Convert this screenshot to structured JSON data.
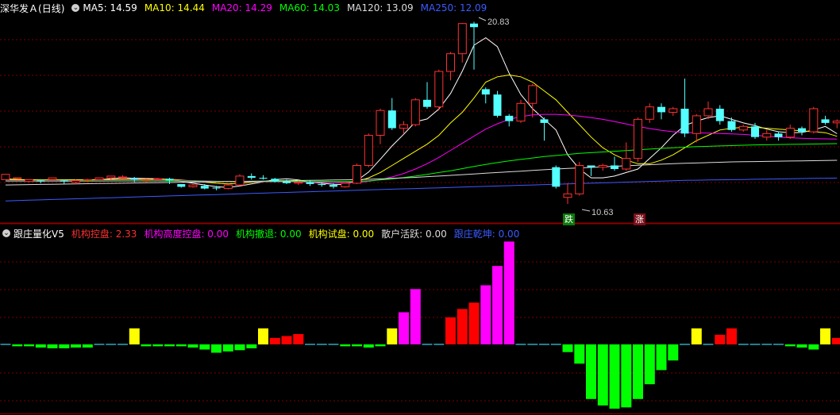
{
  "header_main": {
    "stock": "深华发Ａ",
    "period": "(日线)",
    "indicators": [
      {
        "label": "MA5: 14.59",
        "color": "#ffffff"
      },
      {
        "label": "MA10: 14.44",
        "color": "#ffff00"
      },
      {
        "label": "MA20: 14.29",
        "color": "#ff00ff"
      },
      {
        "label": "MA60: 14.03",
        "color": "#00ff00"
      },
      {
        "label": "MA120: 13.09",
        "color": "#dcdcdc"
      },
      {
        "label": "MA250: 12.09",
        "color": "#3b5bff"
      }
    ]
  },
  "header_sub": {
    "name": "跟庄量化V5",
    "indicators": [
      {
        "label": "机构控盘: 2.33",
        "color": "#ff3030"
      },
      {
        "label": "机构高度控盘: 0.00",
        "color": "#ff00ff"
      },
      {
        "label": "机构撤退: 0.00",
        "color": "#00ff00"
      },
      {
        "label": "机构试盘: 0.00",
        "color": "#ffff00"
      },
      {
        "label": "散户活跃: 0.00",
        "color": "#dcdcdc"
      },
      {
        "label": "跟庄乾坤: 0.00",
        "color": "#3b5bff"
      }
    ]
  },
  "annotations": {
    "high": "20.83",
    "low": "10.63",
    "fall_marker": "跌",
    "rise_marker": "涨"
  },
  "colors": {
    "up": "#ff3030",
    "down": "#54ffff",
    "ma5": "#ffffff",
    "ma10": "#ffff00",
    "ma20": "#ff00ff",
    "ma60": "#00ff00",
    "ma120": "#dcdcdc",
    "ma250": "#3b5bff",
    "grid": "#7a0000",
    "separator": "#8b0000"
  },
  "chart_data": [
    {
      "type": "candlestick",
      "title": "深华发Ａ (日线)",
      "price_range": [
        10.0,
        21.8
      ],
      "candles": [
        [
          12.0,
          12.3,
          12.0,
          12.1
        ],
        [
          12.1,
          12.1,
          11.95,
          11.9
        ],
        [
          11.9,
          12.0,
          11.85,
          11.95
        ],
        [
          11.95,
          11.9,
          11.8,
          12.0
        ],
        [
          12.0,
          12.1,
          11.9,
          11.95
        ],
        [
          11.95,
          11.9,
          11.75,
          12.0
        ],
        [
          11.85,
          11.95,
          11.75,
          12.0
        ],
        [
          11.95,
          12.0,
          11.85,
          12.05
        ],
        [
          12.0,
          12.1,
          11.95,
          12.1
        ],
        [
          12.1,
          12.2,
          12.0,
          12.15
        ],
        [
          12.15,
          12.15,
          12.05,
          12.25
        ],
        [
          12.1,
          12.0,
          11.85,
          12.15
        ],
        [
          11.95,
          12.0,
          11.85,
          12.05
        ],
        [
          12.0,
          12.05,
          11.9,
          12.1
        ],
        [
          12.05,
          11.95,
          11.75,
          12.1
        ],
        [
          11.75,
          11.6,
          11.55,
          11.75
        ],
        [
          11.6,
          11.7,
          11.55,
          11.75
        ],
        [
          11.65,
          11.5,
          11.45,
          11.75
        ],
        [
          11.55,
          11.5,
          11.4,
          11.65
        ],
        [
          11.5,
          11.7,
          11.45,
          11.75
        ],
        [
          11.7,
          12.2,
          11.65,
          12.3
        ],
        [
          12.2,
          12.1,
          12.0,
          12.35
        ],
        [
          12.1,
          12.05,
          12.0,
          12.25
        ],
        [
          12.05,
          11.9,
          11.85,
          12.1
        ],
        [
          11.9,
          11.8,
          11.75,
          12.0
        ],
        [
          11.8,
          11.85,
          11.7,
          11.95
        ],
        [
          11.85,
          11.75,
          11.65,
          11.95
        ],
        [
          11.75,
          11.7,
          11.6,
          11.85
        ],
        [
          11.7,
          11.6,
          11.5,
          11.8
        ],
        [
          11.6,
          11.8,
          11.55,
          11.85
        ],
        [
          11.8,
          12.8,
          11.75,
          12.9
        ],
        [
          12.8,
          14.5,
          12.7,
          14.6
        ],
        [
          14.5,
          15.9,
          14.0,
          16.0
        ],
        [
          15.9,
          14.9,
          14.8,
          16.6
        ],
        [
          14.9,
          15.1,
          14.6,
          15.3
        ],
        [
          15.1,
          16.5,
          15.0,
          16.6
        ],
        [
          16.5,
          16.1,
          16.0,
          17.5
        ],
        [
          16.1,
          18.1,
          15.9,
          18.2
        ],
        [
          18.1,
          19.1,
          17.6,
          19.2
        ],
        [
          19.1,
          20.8,
          18.6,
          20.83
        ],
        [
          20.8,
          20.6,
          18.2,
          20.9
        ],
        [
          17.1,
          16.8,
          16.3,
          17.2
        ],
        [
          16.8,
          15.6,
          15.5,
          17.0
        ],
        [
          15.6,
          15.3,
          15.0,
          15.7
        ],
        [
          15.3,
          16.3,
          15.2,
          16.5
        ],
        [
          16.3,
          17.3,
          15.5,
          17.4
        ],
        [
          15.4,
          15.2,
          14.2,
          15.5
        ],
        [
          12.7,
          11.6,
          11.5,
          12.8
        ],
        [
          11.0,
          11.2,
          10.63,
          11.8
        ],
        [
          11.2,
          12.8,
          11.1,
          13.0
        ],
        [
          12.8,
          12.7,
          12.2,
          12.8
        ],
        [
          12.7,
          12.8,
          12.5,
          12.9
        ],
        [
          12.8,
          12.6,
          12.5,
          13.3
        ],
        [
          12.6,
          13.2,
          12.5,
          14.1
        ],
        [
          13.2,
          15.4,
          13.0,
          15.5
        ],
        [
          15.4,
          16.1,
          15.2,
          16.3
        ],
        [
          16.1,
          15.8,
          15.4,
          16.3
        ],
        [
          15.8,
          16.0,
          15.6,
          16.1
        ],
        [
          16.0,
          14.6,
          14.4,
          17.7
        ],
        [
          14.6,
          15.6,
          14.1,
          15.7
        ],
        [
          15.6,
          16.0,
          15.4,
          16.4
        ],
        [
          16.0,
          15.3,
          15.1,
          16.2
        ],
        [
          15.3,
          14.8,
          14.7,
          15.5
        ],
        [
          14.8,
          15.0,
          14.7,
          15.1
        ],
        [
          15.0,
          14.4,
          14.3,
          15.2
        ],
        [
          14.4,
          14.6,
          14.2,
          14.8
        ],
        [
          14.6,
          14.4,
          14.2,
          14.7
        ],
        [
          14.4,
          14.9,
          14.3,
          15.1
        ],
        [
          14.9,
          14.7,
          14.5,
          15.0
        ],
        [
          14.7,
          16.0,
          14.6,
          16.1
        ],
        [
          15.4,
          15.2,
          15.1,
          15.6
        ],
        [
          15.2,
          15.3,
          14.9,
          15.4
        ]
      ],
      "ma": {
        "ma5": [
          12.05,
          12.0,
          11.98,
          11.97,
          11.97,
          11.98,
          11.98,
          11.98,
          12.0,
          12.05,
          12.1,
          12.08,
          12.06,
          12.05,
          12.0,
          11.9,
          11.8,
          11.7,
          11.6,
          11.56,
          11.64,
          11.76,
          11.88,
          12.0,
          12.05,
          11.98,
          11.86,
          11.8,
          11.74,
          11.72,
          11.95,
          12.43,
          13.15,
          13.9,
          14.56,
          15.26,
          15.42,
          15.98,
          16.86,
          18.12,
          19.58,
          20.0,
          19.5,
          18.0,
          16.8,
          16.0,
          15.4,
          14.8,
          13.4,
          12.6,
          12.1,
          12.1,
          12.2,
          12.4,
          12.6,
          13.2,
          13.8,
          14.5,
          15.05,
          15.3,
          15.5,
          15.6,
          15.4,
          15.2,
          15.05,
          14.85,
          14.7,
          14.64,
          14.66,
          14.8,
          15.0,
          14.59
        ],
        "ma10": [
          12.0,
          12.0,
          12.0,
          11.99,
          11.99,
          11.99,
          11.99,
          11.99,
          12.0,
          12.01,
          12.02,
          12.02,
          12.02,
          12.03,
          12.02,
          11.98,
          11.92,
          11.86,
          11.8,
          11.76,
          11.8,
          11.85,
          11.9,
          11.92,
          11.92,
          11.9,
          11.88,
          11.86,
          11.84,
          11.82,
          11.9,
          12.1,
          12.4,
          12.8,
          13.2,
          13.6,
          14.0,
          14.5,
          15.2,
          15.8,
          16.6,
          17.5,
          17.8,
          17.9,
          17.8,
          17.5,
          17.0,
          16.5,
          15.8,
          15.1,
          14.4,
          13.8,
          13.4,
          13.1,
          12.9,
          12.9,
          13.1,
          13.4,
          13.8,
          14.2,
          14.5,
          14.8,
          14.9,
          14.95,
          14.95,
          14.9,
          14.85,
          14.8,
          14.75,
          14.7,
          14.65,
          14.44
        ],
        "ma20": [
          11.95,
          11.95,
          11.95,
          11.95,
          11.95,
          11.95,
          11.95,
          11.95,
          11.96,
          11.96,
          11.97,
          11.97,
          11.97,
          11.97,
          11.97,
          11.96,
          11.95,
          11.93,
          11.91,
          11.89,
          11.88,
          11.88,
          11.88,
          11.88,
          11.88,
          11.87,
          11.86,
          11.85,
          11.84,
          11.83,
          11.84,
          11.9,
          12.0,
          12.15,
          12.35,
          12.6,
          12.9,
          13.25,
          13.65,
          14.05,
          14.45,
          14.85,
          15.15,
          15.4,
          15.55,
          15.65,
          15.68,
          15.68,
          15.64,
          15.58,
          15.5,
          15.4,
          15.28,
          15.14,
          15.0,
          14.88,
          14.78,
          14.7,
          14.66,
          14.64,
          14.62,
          14.6,
          14.58,
          14.55,
          14.5,
          14.45,
          14.4,
          14.36,
          14.33,
          14.31,
          14.3,
          14.29
        ],
        "ma60": [
          11.9,
          11.9,
          11.9,
          11.9,
          11.9,
          11.9,
          11.91,
          11.91,
          11.91,
          11.92,
          11.92,
          11.92,
          11.92,
          11.92,
          11.92,
          11.91,
          11.91,
          11.9,
          11.9,
          11.89,
          11.89,
          11.89,
          11.89,
          11.89,
          11.89,
          11.89,
          11.89,
          11.89,
          11.89,
          11.89,
          11.9,
          11.93,
          11.98,
          12.04,
          12.12,
          12.2,
          12.3,
          12.4,
          12.5,
          12.62,
          12.74,
          12.86,
          12.96,
          13.06,
          13.14,
          13.22,
          13.3,
          13.36,
          13.42,
          13.48,
          13.52,
          13.56,
          13.6,
          13.64,
          13.68,
          13.72,
          13.76,
          13.8,
          13.83,
          13.86,
          13.88,
          13.9,
          13.92,
          13.94,
          13.96,
          13.97,
          13.98,
          13.99,
          14.0,
          14.01,
          14.02,
          14.03
        ],
        "ma120": [
          11.7,
          11.71,
          11.72,
          11.73,
          11.74,
          11.75,
          11.76,
          11.77,
          11.78,
          11.79,
          11.8,
          11.81,
          11.82,
          11.83,
          11.84,
          11.85,
          11.86,
          11.87,
          11.88,
          11.89,
          11.9,
          11.91,
          11.92,
          11.93,
          11.94,
          11.95,
          11.96,
          11.97,
          11.98,
          11.99,
          12.0,
          12.02,
          12.04,
          12.07,
          12.1,
          12.13,
          12.17,
          12.2,
          12.24,
          12.28,
          12.32,
          12.36,
          12.4,
          12.44,
          12.48,
          12.52,
          12.56,
          12.6,
          12.63,
          12.66,
          12.69,
          12.72,
          12.75,
          12.78,
          12.81,
          12.84,
          12.87,
          12.9,
          12.92,
          12.94,
          12.96,
          12.98,
          13.0,
          13.01,
          13.02,
          13.03,
          13.04,
          13.05,
          13.06,
          13.07,
          13.08,
          13.09
        ],
        "ma250": [
          10.8,
          10.82,
          10.84,
          10.86,
          10.88,
          10.9,
          10.92,
          10.94,
          10.96,
          10.98,
          11.0,
          11.02,
          11.04,
          11.06,
          11.08,
          11.1,
          11.12,
          11.14,
          11.16,
          11.18,
          11.2,
          11.22,
          11.24,
          11.26,
          11.28,
          11.3,
          11.32,
          11.34,
          11.36,
          11.38,
          11.4,
          11.42,
          11.44,
          11.46,
          11.48,
          11.5,
          11.52,
          11.54,
          11.56,
          11.58,
          11.6,
          11.62,
          11.64,
          11.66,
          11.68,
          11.7,
          11.72,
          11.74,
          11.76,
          11.78,
          11.8,
          11.82,
          11.84,
          11.86,
          11.88,
          11.9,
          11.92,
          11.94,
          11.96,
          11.97,
          11.98,
          11.99,
          12.0,
          12.01,
          12.02,
          12.03,
          12.04,
          12.05,
          12.06,
          12.07,
          12.08,
          12.09
        ]
      }
    },
    {
      "type": "bar",
      "title": "跟庄量化V5",
      "ylim": [
        -12,
        20
      ],
      "values": [
        0,
        -0.3,
        -0.3,
        -0.5,
        -0.6,
        -0.6,
        -0.5,
        -0.5,
        0,
        0,
        0,
        2.5,
        -0.3,
        -0.3,
        -0.3,
        -0.3,
        -0.5,
        -0.8,
        -1.3,
        -1.1,
        -0.9,
        -0.6,
        2.5,
        1.0,
        1.3,
        1.6,
        0,
        0,
        0,
        -0.3,
        -0.3,
        -0.5,
        -0.3,
        2.5,
        5.0,
        8.6,
        0,
        0,
        4.2,
        5.5,
        6.5,
        9.2,
        12.2,
        16.0,
        0,
        0,
        0,
        0,
        -1.2,
        -3.0,
        -8.5,
        -9.5,
        -10.0,
        -9.8,
        -8.5,
        -6.2,
        -4.0,
        -2.5,
        0,
        2.5,
        0,
        1.5,
        2.5,
        0,
        0,
        0,
        0,
        -0.3,
        -0.5,
        -0.8,
        2.5,
        1.0,
        1.2
      ],
      "bar_types": [
        "z",
        "g",
        "g",
        "g",
        "g",
        "g",
        "g",
        "g",
        "z",
        "z",
        "z",
        "y",
        "g",
        "g",
        "g",
        "g",
        "g",
        "g",
        "g",
        "g",
        "g",
        "g",
        "y",
        "r",
        "r",
        "r",
        "z",
        "z",
        "z",
        "g",
        "g",
        "g",
        "g",
        "y",
        "m",
        "m",
        "z",
        "z",
        "r",
        "r",
        "r",
        "m",
        "m",
        "m",
        "z",
        "z",
        "z",
        "z",
        "g",
        "g",
        "g",
        "g",
        "g",
        "g",
        "g",
        "g",
        "g",
        "g",
        "z",
        "y",
        "z",
        "r",
        "r",
        "z",
        "z",
        "z",
        "z",
        "g",
        "g",
        "g",
        "y",
        "r",
        "r"
      ]
    }
  ]
}
